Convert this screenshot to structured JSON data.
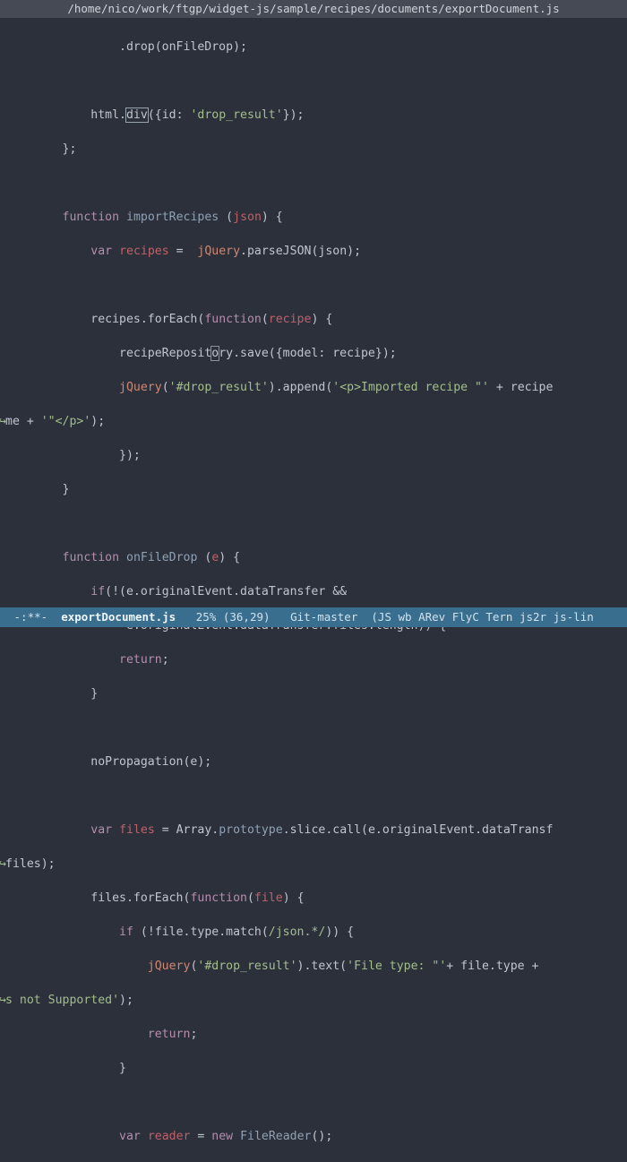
{
  "titlebar": {
    "path": "/home/nico/work/ftgp/widget-js/sample/recipes/documents/exportDocument.js"
  },
  "code": {
    "l1a": "                .drop(onFileDrop);",
    "l2": " ",
    "l3_a": "            html.",
    "l3_b": "div",
    "l3_c": "({id: ",
    "l3_d": "'drop_result'",
    "l3_e": "});",
    "l4": "        };",
    "l5": " ",
    "l6_a": "        ",
    "l6_kw": "function",
    "l6_sp": " ",
    "l6_nm": "importRecipes",
    "l6_b": " (",
    "l6_p": "json",
    "l6_c": ") {",
    "l7_a": "            ",
    "l7_kw": "var",
    "l7_b": " ",
    "l7_v": "recipes",
    "l7_c": " =  ",
    "l7_jq": "jQuery",
    "l7_d": ".parseJSON(json);",
    "l8": " ",
    "l9_a": "            recipes.forEach(",
    "l9_kw": "function",
    "l9_b": "(",
    "l9_p": "recipe",
    "l9_c": ") {",
    "l10_a": "                recipeReposit",
    "l10_o": "o",
    "l10_b": "ry.save({model: recipe});",
    "l11_a": "                ",
    "l11_jq": "jQuery",
    "l11_b": "(",
    "l11_s1": "'#drop_result'",
    "l11_c": ").append(",
    "l11_s2": "'<p>Imported recipe \"'",
    "l11_d": " + recipe",
    "l12_g": "↪",
    "l12_a": "me + ",
    "l12_s": "'\"</p>'",
    "l12_b": ");",
    "l13": "                });",
    "l14": "        }",
    "l15": " ",
    "l16_a": "        ",
    "l16_kw": "function",
    "l16_sp": " ",
    "l16_nm": "onFileDrop",
    "l16_b": " (",
    "l16_p": "e",
    "l16_c": ") {",
    "l17_a": "            ",
    "l17_kw": "if",
    "l17_b": "(!(e.originalEvent.dataTransfer &&",
    "l18": "                 e.originalEvent.dataTransfer.files.length)) {",
    "l19_a": "                ",
    "l19_kw": "return",
    "l19_b": ";",
    "l20": "            }",
    "l21": " ",
    "l22": "            noPropagation(e);",
    "l23": " ",
    "l24_a": "            ",
    "l24_kw": "var",
    "l24_b": " ",
    "l24_v": "files",
    "l24_c": " = Array.",
    "l24_p": "prototype",
    "l24_d": ".slice.call(e.originalEvent.dataTransf",
    "l25_g": "↪",
    "l25": "files);",
    "l26_a": "            files.forEach(",
    "l26_kw": "function",
    "l26_b": "(",
    "l26_p": "file",
    "l26_c": ") {",
    "l27_a": "                ",
    "l27_kw": "if",
    "l27_b": " (!file.type.match(",
    "l27_r": "/json.*/",
    "l27_c": ")) {",
    "l28_a": "                    ",
    "l28_jq": "jQuery",
    "l28_b": "(",
    "l28_s1": "'#drop_result'",
    "l28_c": ").text(",
    "l28_s2": "'File type: \"'",
    "l28_d": "+ file.type + ",
    "l29_g": "↪",
    "l29_a": "s not Supported'",
    "l29_b": ");",
    "l30_a": "                    ",
    "l30_kw": "return",
    "l30_b": ";",
    "l31": "                }",
    "l32": " ",
    "l33_a": "                ",
    "l33_kw": "var",
    "l33_b": " ",
    "l33_v": "reader",
    "l33_c": " = ",
    "l33_kw2": "new",
    "l33_d": " ",
    "l33_cn": "FileReader",
    "l33_e": "();"
  },
  "modeline": {
    "left": " -:**-  ",
    "filename": "exportDocument.js",
    "percent": "   25% (36,29)   ",
    "branch": "Git-master",
    "modes": "  (JS wb ARev FlyC Tern js2r js-lin"
  }
}
